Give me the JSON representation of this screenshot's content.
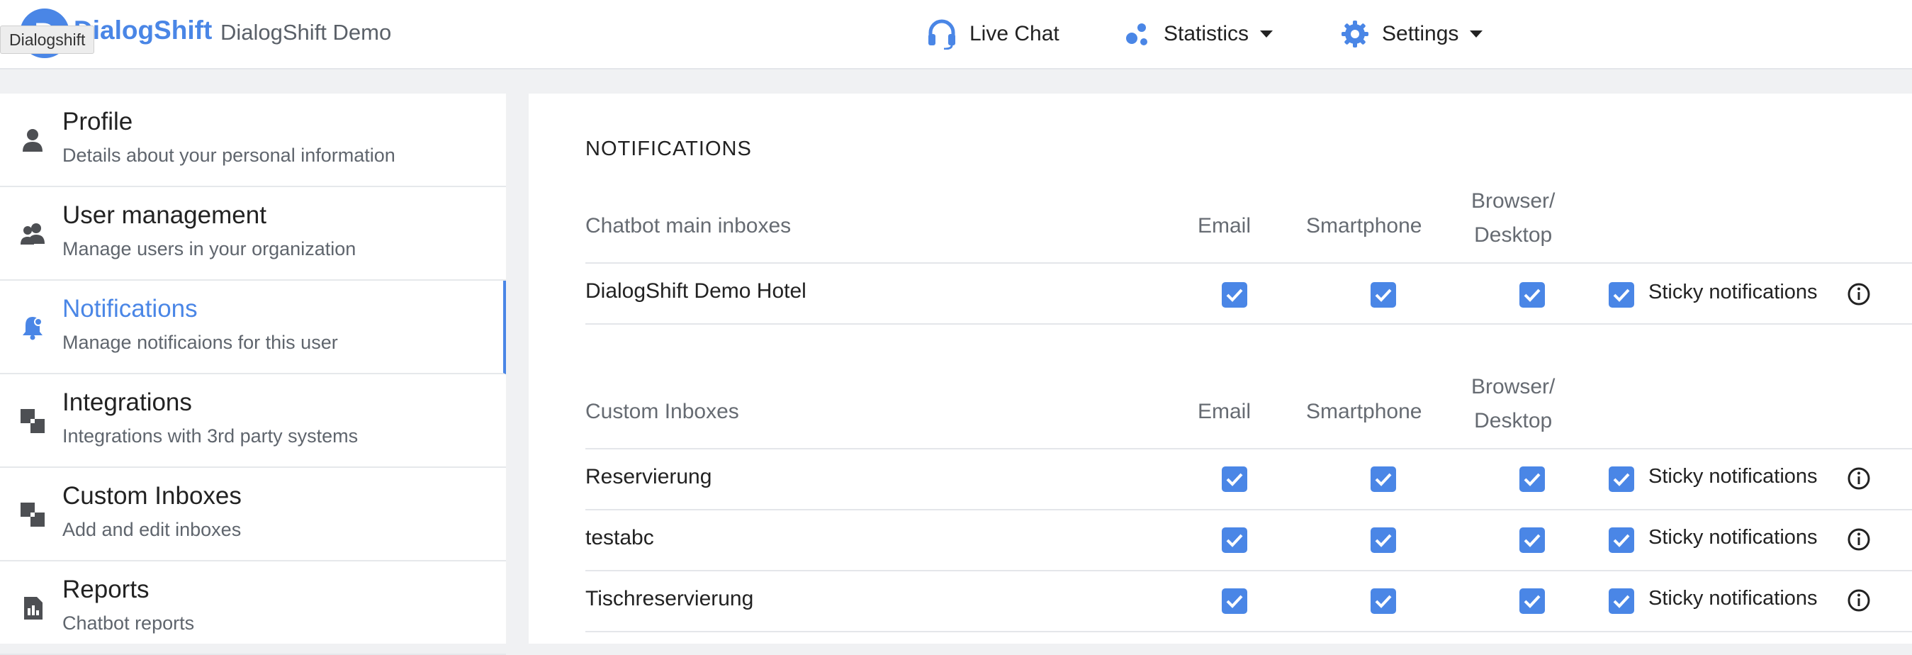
{
  "app": {
    "logo_letter": "D",
    "brand": "DialogShift",
    "org_name": "DialogShift Demo",
    "tooltip": "Dialogshift",
    "accent_color": "#4a86e6"
  },
  "nav": {
    "live_chat": "Live Chat",
    "statistics": "Statistics",
    "settings": "Settings"
  },
  "sidebar": {
    "items": [
      {
        "title": "Profile",
        "subtitle": "Details about your personal information",
        "icon": "person-icon"
      },
      {
        "title": "User management",
        "subtitle": "Manage users in your organization",
        "icon": "users-icon"
      },
      {
        "title": "Notifications",
        "subtitle": "Manage notificaions for this user",
        "icon": "bell-icon",
        "active": true
      },
      {
        "title": "Integrations",
        "subtitle": "Integrations with 3rd party systems",
        "icon": "squares-icon"
      },
      {
        "title": "Custom Inboxes",
        "subtitle": "Add and edit inboxes",
        "icon": "squares-icon"
      },
      {
        "title": "Reports",
        "subtitle": "Chatbot reports",
        "icon": "report-icon"
      }
    ]
  },
  "notifications": {
    "title": "NOTIFICATIONS",
    "sticky_label": "Sticky notifications",
    "main_table": {
      "heading": "Chatbot main inboxes",
      "col_email": "Email",
      "col_smartphone": "Smartphone",
      "col_browser_1": "Browser/",
      "col_browser_2": "Desktop",
      "rows": [
        {
          "name": "DialogShift Demo Hotel",
          "email": true,
          "smartphone": true,
          "browser": true,
          "sticky": true
        }
      ]
    },
    "custom_table": {
      "heading": "Custom Inboxes",
      "col_email": "Email",
      "col_smartphone": "Smartphone",
      "col_browser_1": "Browser/",
      "col_browser_2": "Desktop",
      "rows": [
        {
          "name": "Reservierung",
          "email": true,
          "smartphone": true,
          "browser": true,
          "sticky": true
        },
        {
          "name": "testabc",
          "email": true,
          "smartphone": true,
          "browser": true,
          "sticky": true
        },
        {
          "name": "Tischreservierung",
          "email": true,
          "smartphone": true,
          "browser": true,
          "sticky": true
        }
      ]
    }
  }
}
